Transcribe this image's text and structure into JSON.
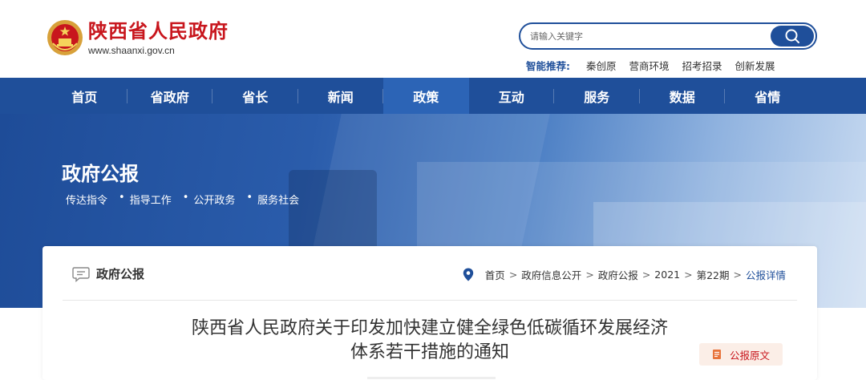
{
  "site": {
    "name": "陕西省人民政府",
    "url": "www.shaanxi.gov.cn"
  },
  "search": {
    "placeholder": "请输入关键字"
  },
  "recommend": {
    "label": "智能推荐:",
    "items": [
      "秦创原",
      "营商环境",
      "招考招录",
      "创新发展"
    ]
  },
  "nav": {
    "items": [
      "首页",
      "省政府",
      "省长",
      "新闻",
      "政策",
      "互动",
      "服务",
      "数据",
      "省情"
    ],
    "active": "政策"
  },
  "banner": {
    "title": "政府公报",
    "tags": [
      "传达指令",
      "指导工作",
      "公开政务",
      "服务社会"
    ]
  },
  "section": {
    "title": "政府公报"
  },
  "breadcrumb": {
    "items": [
      "首页",
      "政府信息公开",
      "政府公报",
      "2021",
      "第22期"
    ],
    "current": "公报详情",
    "separator": ">"
  },
  "article": {
    "title_line1": "陕西省人民政府关于印发加快建立健全绿色低碳循环发展经济",
    "title_line2": "体系若干措施的通知",
    "original_label": "公报原文"
  },
  "colors": {
    "brand_red": "#c8161d",
    "nav_blue": "#1f4f9a",
    "nav_active": "#2c64b6"
  }
}
